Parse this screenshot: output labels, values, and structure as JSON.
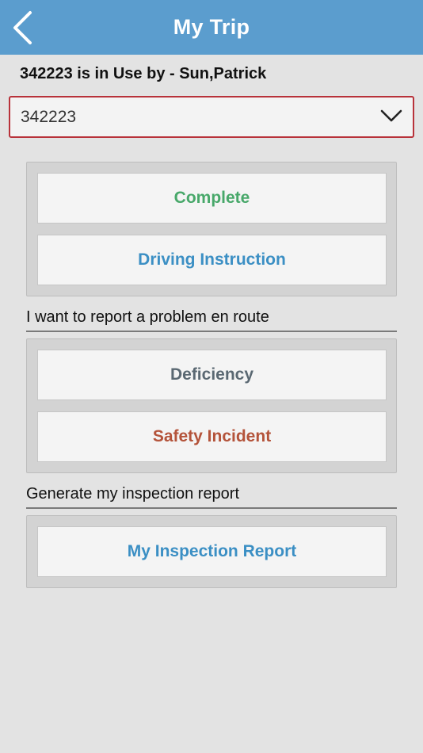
{
  "header": {
    "title": "My Trip",
    "back_icon": "chevron-left-icon"
  },
  "status": {
    "in_use_text": "342223 is in Use by - Sun,Patrick"
  },
  "vehicle_select": {
    "value": "342223",
    "chevron_icon": "chevron-down-icon"
  },
  "trip_actions": {
    "complete_label": "Complete",
    "driving_instruction_label": "Driving Instruction"
  },
  "report_section": {
    "label": "I want to report a problem en route",
    "deficiency_label": "Deficiency",
    "safety_incident_label": "Safety Incident"
  },
  "inspection_section": {
    "label": "Generate my inspection report",
    "my_inspection_report_label": "My Inspection Report"
  },
  "colors": {
    "header_bg": "#5b9dce",
    "complete": "#48a86a",
    "driving_instruction": "#3b8fc4",
    "deficiency": "#5a6872",
    "safety_incident": "#b4533a",
    "my_inspection_report": "#3b8fc4",
    "select_border": "#b8323a"
  }
}
